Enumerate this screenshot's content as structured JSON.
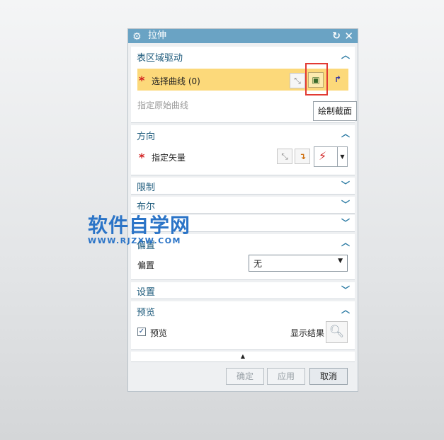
{
  "dialog": {
    "title": "拉伸",
    "icons": {
      "settings": "gear-icon",
      "reset": "reset-icon",
      "close": "close-icon"
    }
  },
  "sections": {
    "surface_drive": {
      "title": "表区域驱动",
      "select_curve_label": "选择曲线 (0)",
      "specify_original_curve": "指定原始曲线"
    },
    "direction": {
      "title": "方向",
      "specify_vector": "指定矢量"
    },
    "limits": {
      "title": "限制"
    },
    "boolean": {
      "title": "布尔"
    },
    "offset_section": {
      "title": "偏置",
      "offset_label": "偏置",
      "offset_value": "无"
    },
    "settings": {
      "title": "设置"
    },
    "preview": {
      "title": "预览",
      "preview_label": "预览",
      "preview_checked": true,
      "show_result_label": "显示结果"
    }
  },
  "tooltip": "绘制截面",
  "buttons": {
    "ok": "确定",
    "apply": "应用",
    "cancel": "取消"
  },
  "watermark": {
    "title": "软件自学网",
    "url": "WWW.RJZXW.COM"
  },
  "colors": {
    "titlebar": "#6aa3c4",
    "selection_highlight": "#fcd97a",
    "section_title": "#1e5b7c",
    "required": "#d21f1f",
    "highlight_box": "#e23a33"
  }
}
